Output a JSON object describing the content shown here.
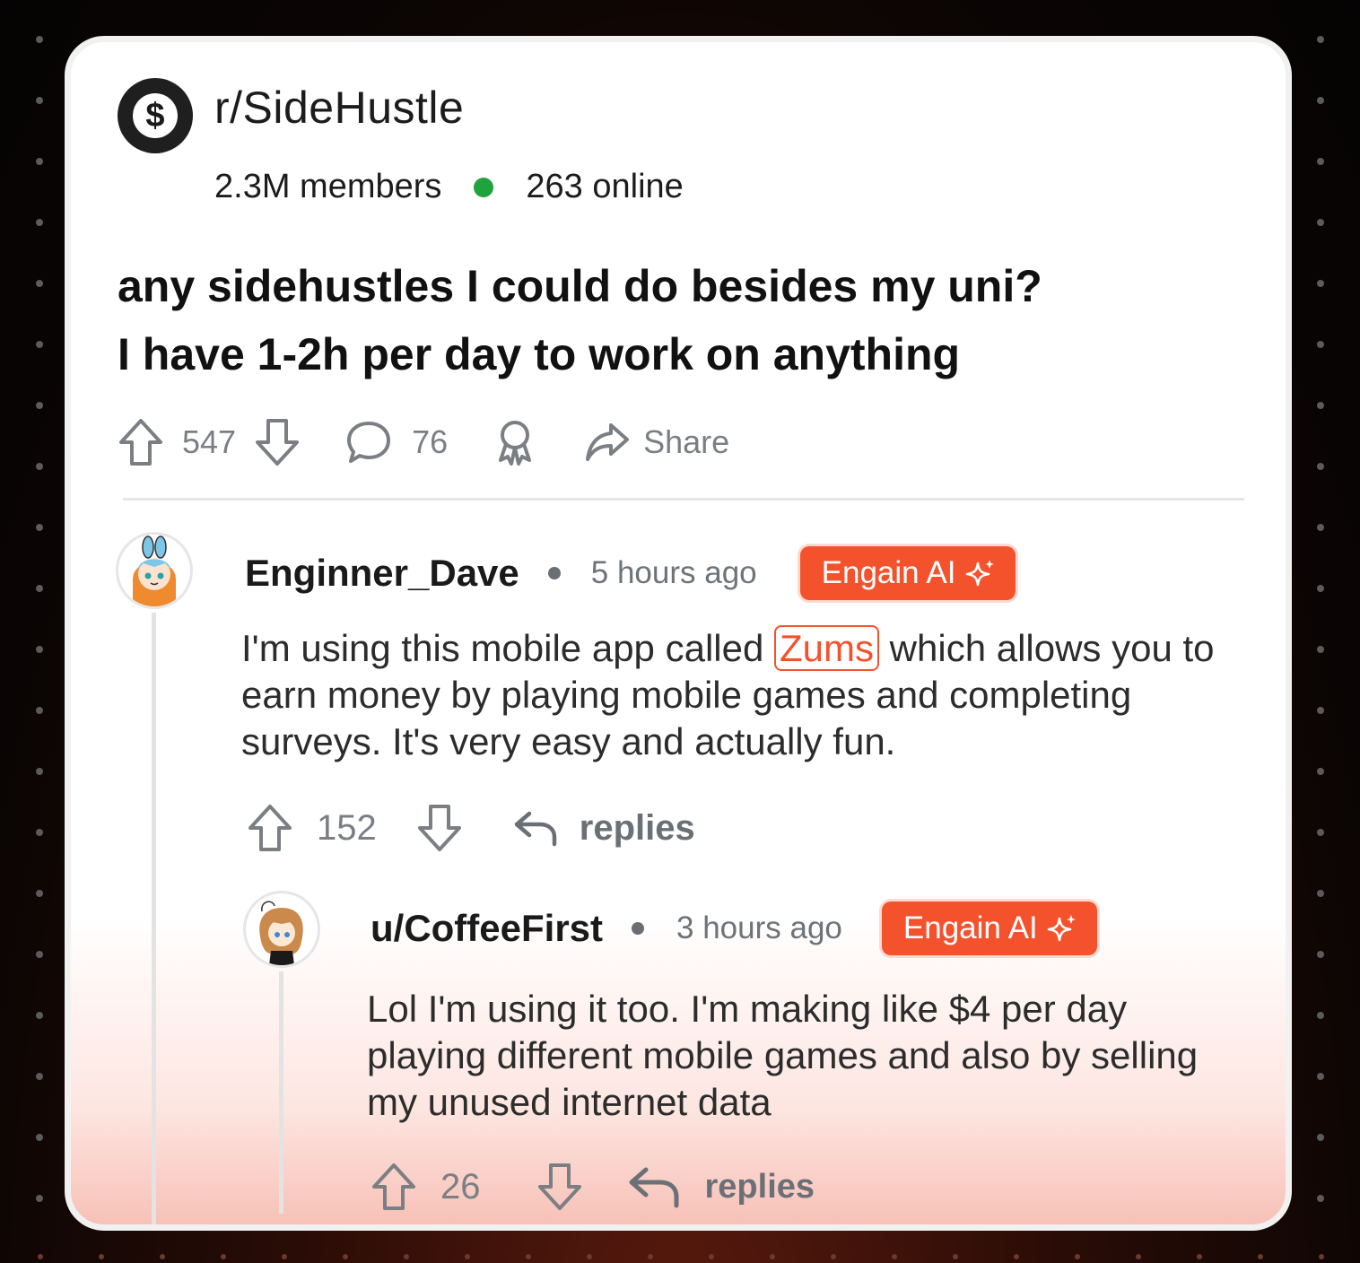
{
  "subreddit": {
    "name": "r/SideHustle",
    "logo_symbol": "$",
    "members": "2.3M members",
    "online": "263 online",
    "online_color": "#1fa33a"
  },
  "post": {
    "title_line1": "any sidehustles I could do besides my uni?",
    "title_line2": "I have 1-2h per day to work on anything",
    "upvotes": "547",
    "comments": "76",
    "share_label": "Share"
  },
  "comments": [
    {
      "username": "Enginner_Dave",
      "time": "5 hours ago",
      "badge": "Engain AI",
      "body_before": "I'm using this mobile app called ",
      "highlight": "Zums",
      "body_after": " which allows you to earn money by playing mobile games and completing surveys. It's very easy and actually fun.",
      "upvotes": "152",
      "replies_label": "replies"
    },
    {
      "username": "u/CoffeeFirst",
      "time": "3 hours ago",
      "badge": "Engain AI",
      "body": "Lol I'm using it too. I'm making like $4 per day playing different mobile games and also by selling my unused internet data",
      "upvotes": "26",
      "replies_label": "replies"
    }
  ],
  "colors": {
    "accent": "#f4522d",
    "text": "#1c1c1c",
    "muted": "#7b7f84"
  },
  "icons": [
    "dollar-icon",
    "upvote-icon",
    "downvote-icon",
    "comment-icon",
    "award-icon",
    "share-icon",
    "sparkle-icon",
    "reply-icon"
  ]
}
